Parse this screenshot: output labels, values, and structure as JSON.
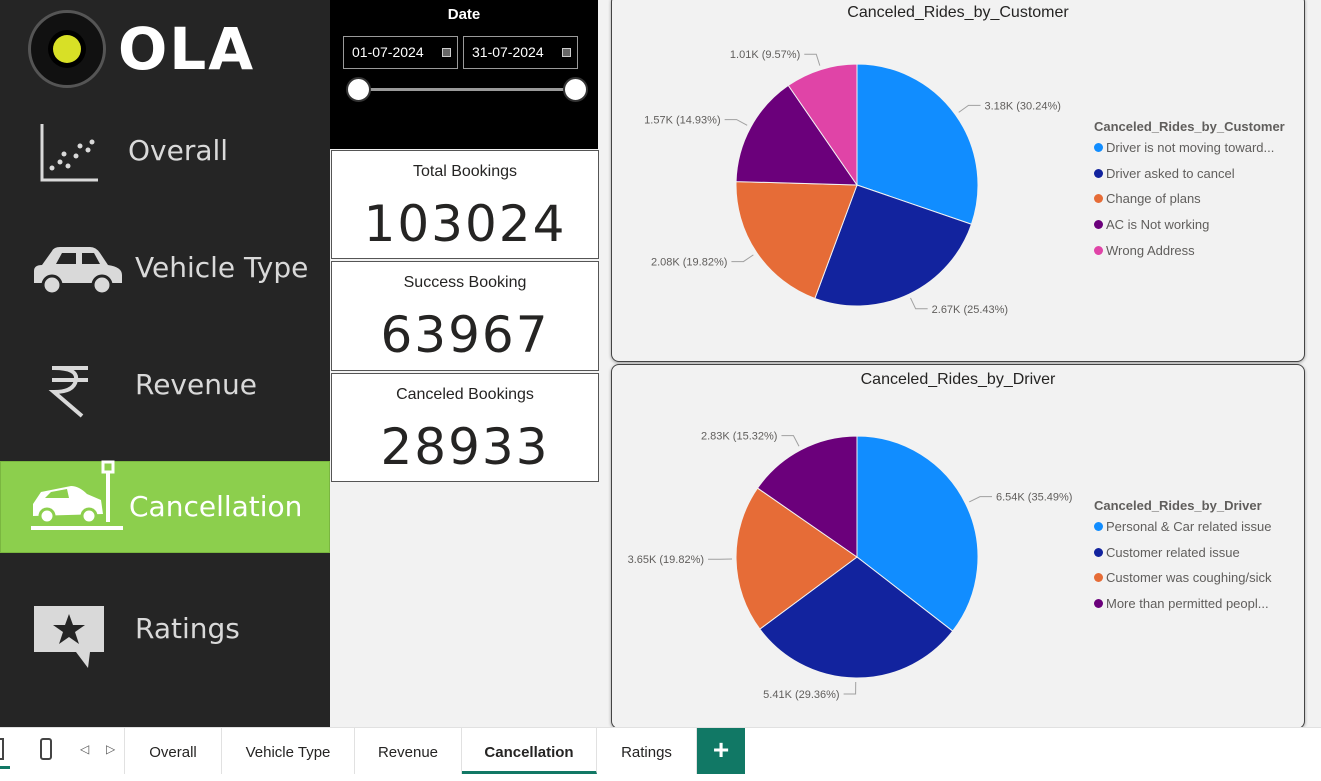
{
  "brand": {
    "name": "OLA"
  },
  "sidebar": {
    "items": [
      {
        "label": "Overall",
        "icon": "scatter-chart-icon",
        "active": false
      },
      {
        "label": "Vehicle Type",
        "icon": "car-icon",
        "active": false
      },
      {
        "label": "Revenue",
        "icon": "rupee-icon",
        "active": false
      },
      {
        "label": "Cancellation",
        "icon": "crashed-car-icon",
        "active": true
      },
      {
        "label": "Ratings",
        "icon": "star-chat-icon",
        "active": false
      }
    ]
  },
  "date_slicer": {
    "title": "Date",
    "start": "01-07-2024",
    "end": "31-07-2024"
  },
  "kpis": [
    {
      "label": "Total Bookings",
      "value": "103024"
    },
    {
      "label": "Success Booking",
      "value": "63967"
    },
    {
      "label": "Canceled Bookings",
      "value": "28933"
    }
  ],
  "chart_data": [
    {
      "type": "pie",
      "title": "Canceled_Rides_by_Customer",
      "legend_title": "Canceled_Rides_by_Customer",
      "legend_placement": "right",
      "categories": [
        "Driver is not moving toward...",
        "Driver asked to cancel",
        "Change of plans",
        "AC is Not working",
        "Wrong Address"
      ],
      "values": [
        3.18,
        2.67,
        2.08,
        1.57,
        1.01
      ],
      "data_labels": [
        "3.18K (30.24%)",
        "2.67K (25.43%)",
        "2.08K (19.82%)",
        "1.57K (14.93%)",
        "1.01K (9.57%)"
      ],
      "colors": [
        "#118dff",
        "#12239e",
        "#e66c37",
        "#6b007b",
        "#e044a7"
      ]
    },
    {
      "type": "pie",
      "title": "Canceled_Rides_by_Driver",
      "legend_title": "Canceled_Rides_by_Driver",
      "legend_placement": "right",
      "categories": [
        "Personal & Car related issue",
        "Customer related issue",
        "Customer was coughing/sick",
        "More than permitted peopl..."
      ],
      "values": [
        6.54,
        5.41,
        3.65,
        2.83
      ],
      "data_labels": [
        "6.54K (35.49%)",
        "5.41K (29.36%)",
        "3.65K (19.82%)",
        "2.83K (15.32%)"
      ],
      "colors": [
        "#118dff",
        "#12239e",
        "#e66c37",
        "#6b007b"
      ]
    }
  ],
  "tabs": [
    {
      "label": "Overall",
      "active": false
    },
    {
      "label": "Vehicle Type",
      "active": false
    },
    {
      "label": "Revenue",
      "active": false
    },
    {
      "label": "Cancellation",
      "active": true
    },
    {
      "label": "Ratings",
      "active": false
    }
  ],
  "add_tab_label": "+"
}
